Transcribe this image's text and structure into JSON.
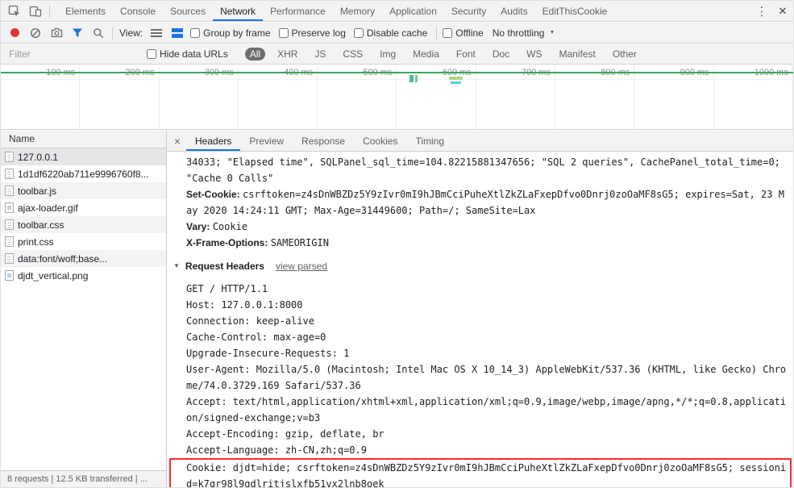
{
  "window": {
    "main_tabs": [
      {
        "label": "Elements"
      },
      {
        "label": "Console"
      },
      {
        "label": "Sources"
      },
      {
        "label": "Network",
        "active": true
      },
      {
        "label": "Performance"
      },
      {
        "label": "Memory"
      },
      {
        "label": "Application"
      },
      {
        "label": "Security"
      },
      {
        "label": "Audits"
      },
      {
        "label": "EditThisCookie"
      }
    ],
    "kebab": "⋮",
    "close": "✕"
  },
  "network_toolbar": {
    "view_label": "View:",
    "checkboxes": [
      {
        "label": "Group by frame",
        "checked": false
      },
      {
        "label": "Preserve log",
        "checked": false
      },
      {
        "label": "Disable cache",
        "checked": false
      }
    ],
    "offline_label": "Offline",
    "throttling_value": "No throttling"
  },
  "filter_bar": {
    "filter_placeholder": "Filter",
    "hide_data_urls_label": "Hide data URLs",
    "type_filters": [
      {
        "label": "All",
        "active": true
      },
      {
        "label": "XHR"
      },
      {
        "label": "JS"
      },
      {
        "label": "CSS"
      },
      {
        "label": "Img"
      },
      {
        "label": "Media"
      },
      {
        "label": "Font"
      },
      {
        "label": "Doc"
      },
      {
        "label": "WS"
      },
      {
        "label": "Manifest"
      },
      {
        "label": "Other"
      }
    ]
  },
  "timeline": {
    "ticks": [
      "100 ms",
      "200 ms",
      "300 ms",
      "400 ms",
      "500 ms",
      "600 ms",
      "700 ms",
      "800 ms",
      "900 ms",
      "1000 ms"
    ]
  },
  "request_list": {
    "name_header": "Name",
    "rows": [
      {
        "name": "127.0.0.1",
        "icon": "document-icon",
        "active": true
      },
      {
        "name": "1d1df6220ab711e9996760f8...",
        "icon": "script-icon"
      },
      {
        "name": "toolbar.js",
        "icon": "script-icon"
      },
      {
        "name": "ajax-loader.gif",
        "icon": "image-icon"
      },
      {
        "name": "toolbar.css",
        "icon": "stylesheet-icon"
      },
      {
        "name": "print.css",
        "icon": "stylesheet-icon"
      },
      {
        "name": "data:font/woff;base...",
        "icon": "font-icon"
      },
      {
        "name": "djdt_vertical.png",
        "icon": "image-icon"
      }
    ]
  },
  "details_panel": {
    "close": "×",
    "tabs": [
      {
        "label": "Headers",
        "active": true
      },
      {
        "label": "Preview"
      },
      {
        "label": "Response"
      },
      {
        "label": "Cookies"
      },
      {
        "label": "Timing"
      }
    ],
    "overflow_text": "34033; \"Elapsed time\", SQLPanel_sql_time=104.82215881347656; \"SQL 2 queries\", CachePanel_total_time=0; \"Cache 0 Calls\"",
    "response_headers": [
      {
        "name": "Set-Cookie:",
        "value": "csrftoken=z4sDnWBZDz5Y9zIvr0mI9hJBmCciPuheXtlZkZLaFxepDfvo0Dnrj0zoOaMF8sG5; expires=Sat, 23 May 2020 14:24:11 GMT; Max-Age=31449600; Path=/; SameSite=Lax"
      },
      {
        "name": "Vary:",
        "value": "Cookie"
      },
      {
        "name": "X-Frame-Options:",
        "value": "SAMEORIGIN"
      }
    ],
    "request_headers_label": "Request Headers",
    "view_parsed_label": "view parsed",
    "raw_request_headers": [
      {
        "text": "GET / HTTP/1.1"
      },
      {
        "text": "Host: 127.0.0.1:8000"
      },
      {
        "text": "Connection: keep-alive"
      },
      {
        "text": "Cache-Control: max-age=0"
      },
      {
        "text": "Upgrade-Insecure-Requests: 1"
      },
      {
        "text": "User-Agent: Mozilla/5.0 (Macintosh; Intel Mac OS X 10_14_3) AppleWebKit/537.36 (KHTML, like Gecko) Chrome/74.0.3729.169 Safari/537.36"
      },
      {
        "text": "Accept: text/html,application/xhtml+xml,application/xml;q=0.9,image/webp,image/apng,*/*;q=0.8,application/signed-exchange;v=b3"
      },
      {
        "text": "Accept-Encoding: gzip, deflate, br"
      },
      {
        "text": "Accept-Language: zh-CN,zh;q=0.9"
      },
      {
        "text": "Cookie: djdt=hide; csrftoken=z4sDnWBZDz5Y9zIvr0mI9hJBmCciPuheXtlZkZLaFxepDfvo0Dnrj0zoOaMF8sG5; sessionid=k7qr98l9gdlritjslxfb51vx2lnb8oek",
        "highlighted": true
      }
    ]
  },
  "status_bar": {
    "summary": "8 requests | 12.5 KB transferred | ..."
  },
  "colors": {
    "accent_blue": "#1a73e8",
    "record_red": "#df3434",
    "highlight_red": "#fb2b2b",
    "timeline_green": "#3aa757",
    "toolbar_gray": "#f3f3f3"
  }
}
